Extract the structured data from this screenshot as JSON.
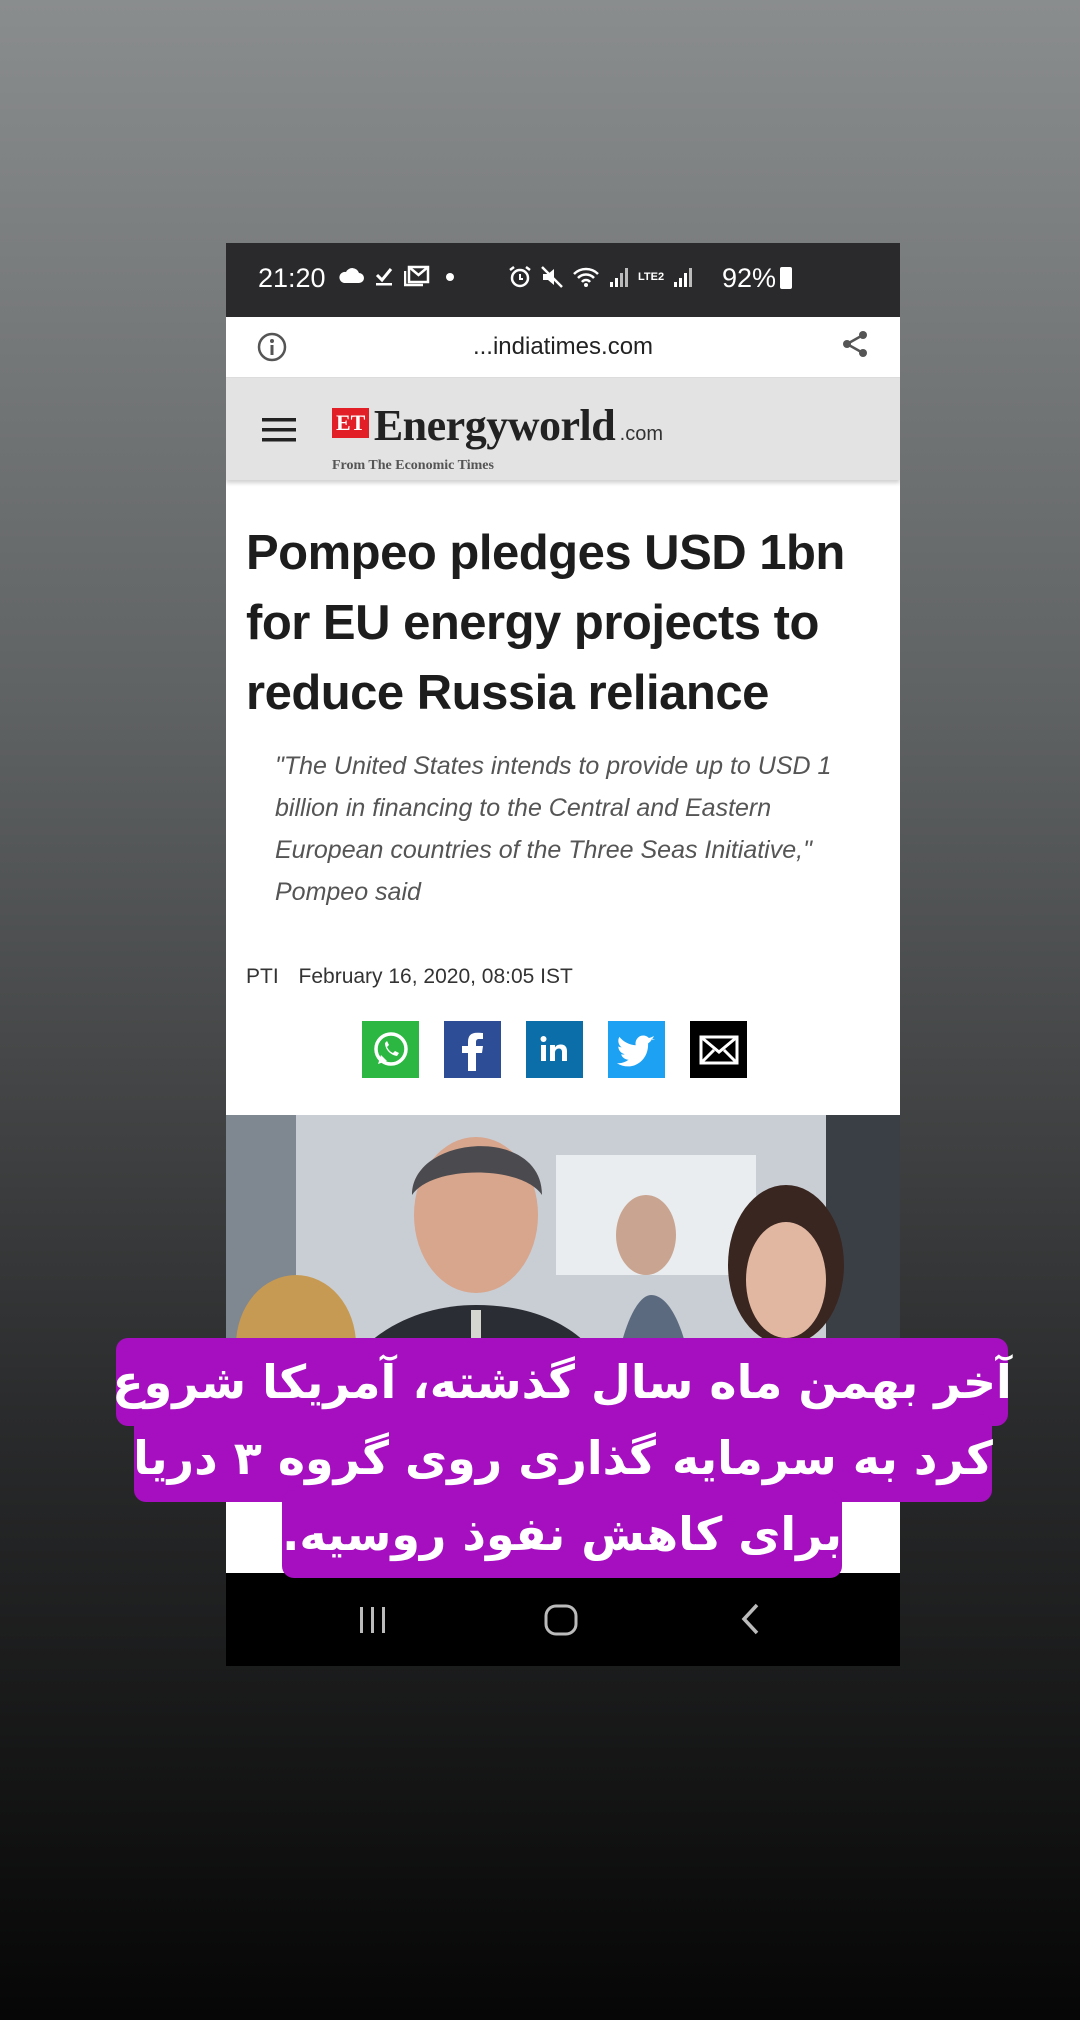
{
  "status_bar": {
    "time": "21:20",
    "battery": "92%",
    "network_label": "LTE2"
  },
  "browser": {
    "url": "...indiatimes.com"
  },
  "site": {
    "logo_et": "ET",
    "logo_name": "Energyworld",
    "logo_tld": ".com",
    "logo_tagline": "From The Economic Times"
  },
  "article": {
    "headline_lines": [
      "Pompeo pledges USD 1bn",
      "for EU energy projects to",
      "reduce Russia reliance"
    ],
    "summary_lines": [
      "\"The United States intends to provide up to USD 1",
      "billion in financing to the Central and Eastern",
      "European countries of the Three Seas Initiative,\"",
      "Pompeo said"
    ],
    "source": "PTI",
    "date": "February 16, 2020, 08:05 IST",
    "share_buttons": [
      "whatsapp-icon",
      "facebook-icon",
      "linkedin-icon",
      "twitter-icon",
      "email-icon"
    ]
  },
  "colors": {
    "caption_bg": "#a50fbf",
    "whatsapp": "#2bb741",
    "facebook": "#2d4d96",
    "linkedin": "#0b6ea8",
    "twitter": "#1da1f2",
    "email": "#000000",
    "logo_red": "#e21f26"
  },
  "caption": {
    "lines": [
      "آخر بهمن ماه سال گذشته، آمریکا شروع",
      "کرد به سرمایه گذاری روی گروه ۳ دریا",
      "برای کاهش نفوذ روسیه."
    ]
  }
}
